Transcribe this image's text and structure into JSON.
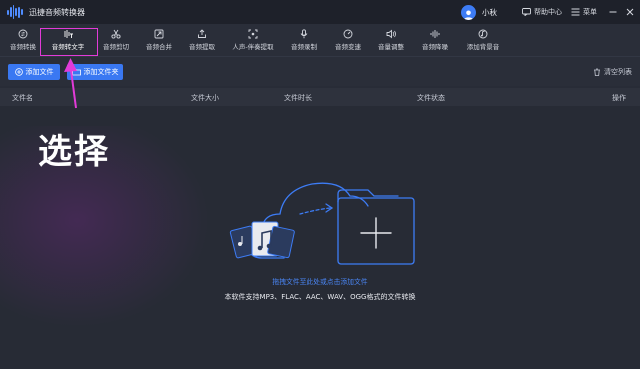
{
  "app": {
    "title": "迅捷音频转换器",
    "username": "小秋",
    "help_label": "帮助中心",
    "menu_label": "菜单"
  },
  "toolbar": {
    "tools": [
      {
        "label": "音频转换",
        "icon": "convert-icon"
      },
      {
        "label": "音频转文字",
        "icon": "audio-text-icon"
      },
      {
        "label": "音频剪切",
        "icon": "scissors-icon"
      },
      {
        "label": "音频合并",
        "icon": "merge-icon"
      },
      {
        "label": "音频提取",
        "icon": "extract-icon"
      },
      {
        "label": "人声-伴奏提取",
        "icon": "vocal-icon"
      },
      {
        "label": "音频录制",
        "icon": "microphone-icon"
      },
      {
        "label": "音频变速",
        "icon": "speed-icon"
      },
      {
        "label": "音量调整",
        "icon": "volume-icon"
      },
      {
        "label": "音频降噪",
        "icon": "denoise-icon"
      },
      {
        "label": "添加背景音",
        "icon": "background-music-icon"
      }
    ],
    "active_index": 1
  },
  "actions": {
    "add_file": "添加文件",
    "add_folder": "添加文件夹",
    "clear_list": "清空列表"
  },
  "table": {
    "columns": [
      "文件名",
      "文件大小",
      "文件时长",
      "文件状态",
      "操作"
    ]
  },
  "annotation": {
    "text": "选择"
  },
  "dropzone": {
    "hint": "拖拽文件至此处或点击添加文件",
    "formats_note": "本软件支持MP3、FLAC、AAC、WAV、OGG格式的文件转换"
  },
  "colors": {
    "accent": "#3a78f2",
    "highlight": "#e23bd8",
    "background": "#282c37"
  }
}
